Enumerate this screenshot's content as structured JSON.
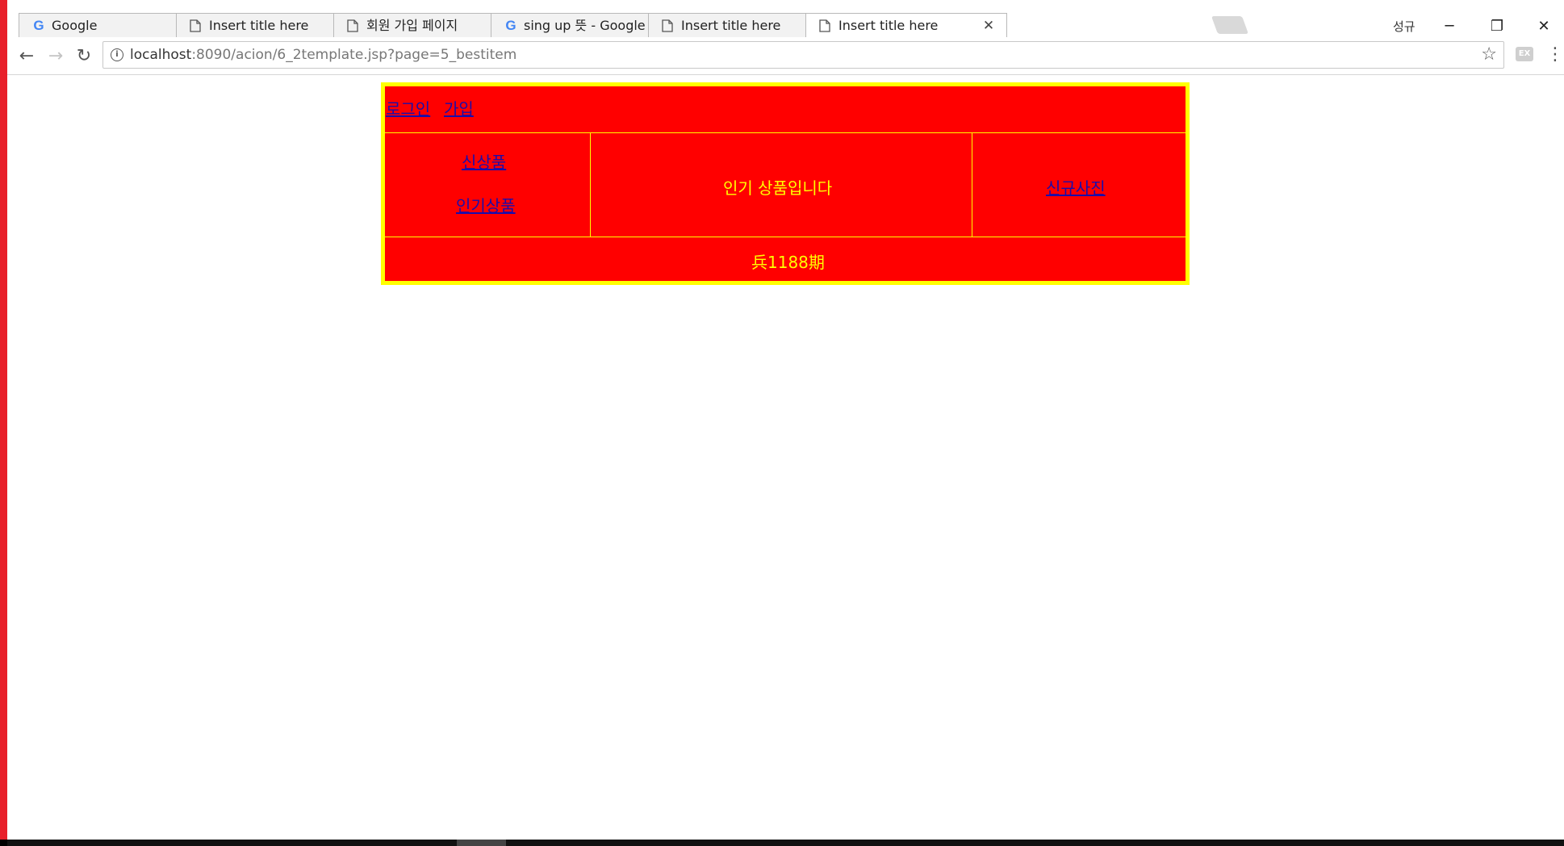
{
  "browser": {
    "tabs": [
      {
        "title": "Google",
        "icon": "google-icon",
        "active": false
      },
      {
        "title": "Insert title here",
        "icon": "page-icon",
        "active": false
      },
      {
        "title": "회원 가입 페이지",
        "icon": "page-icon",
        "active": false
      },
      {
        "title": "sing up 뜻 - Google 검",
        "icon": "google-icon",
        "active": false
      },
      {
        "title": "Insert title here",
        "icon": "page-icon",
        "active": false
      },
      {
        "title": "Insert title here",
        "icon": "page-icon",
        "active": true
      }
    ],
    "profile_name": "성규",
    "address": {
      "host": "localhost",
      "path": ":8090/acion/6_2template.jsp?page=5_bestitem"
    },
    "extension_label": "EX"
  },
  "page": {
    "header_links": {
      "login": "로그인",
      "join": "가입"
    },
    "sidebar_links": {
      "new_item": "신상품",
      "best_item": "인기상품"
    },
    "main_text": "인기 상품입니다",
    "right_link": "신규사진",
    "footer_text": "兵1188期"
  },
  "colors": {
    "page_bg": "#ff0000",
    "border": "#ffff00",
    "text": "#ffff00",
    "link": "#1a0dab"
  }
}
